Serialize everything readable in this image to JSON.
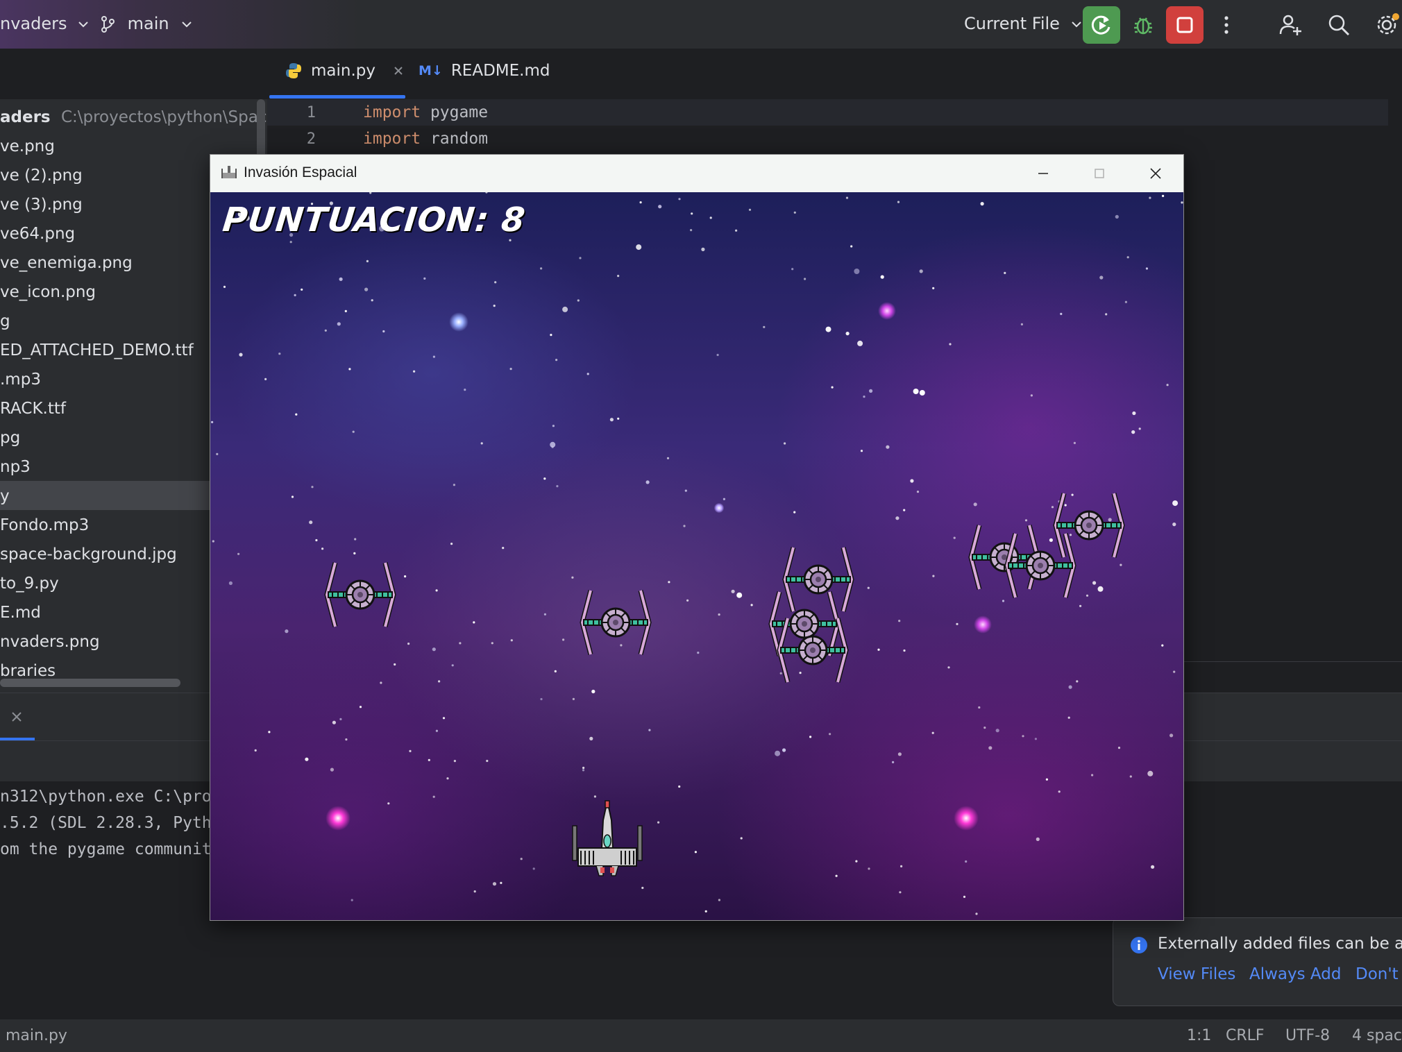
{
  "toolbar": {
    "project_name": "nvaders",
    "branch": "main",
    "run_config": "Current File",
    "colors": {
      "run_green": "#4e9a51",
      "stop_red": "#d1403d",
      "bug_green": "#5fb865"
    }
  },
  "tabs": [
    {
      "label": "main.py",
      "icon": "python-icon"
    },
    {
      "label": "README.md",
      "icon": "markdown-icon"
    }
  ],
  "project_tree": {
    "root_name": "aders",
    "root_path": "C:\\proyectos\\python\\SpaceIn",
    "items": [
      "ve.png",
      "ve (2).png",
      "ve (3).png",
      "ve64.png",
      "ve_enemiga.png",
      "ve_icon.png",
      "g",
      "ED_ATTACHED_DEMO.ttf",
      ".mp3",
      "RACK.ttf",
      "pg",
      "np3",
      "y",
      "Fondo.mp3",
      "space-background.jpg",
      "to_9.py",
      "E.md",
      "nvaders.png",
      "braries"
    ]
  },
  "editor": {
    "lines": [
      {
        "number": "1",
        "keyword": "import",
        "name": "pygame"
      },
      {
        "number": "2",
        "keyword": "import",
        "name": "random"
      }
    ]
  },
  "console": {
    "lines": [
      "n312\\python.exe C:\\pro",
      ".5.2 (SDL 2.28.3, Pyth",
      "om the pygame communit"
    ]
  },
  "game_window": {
    "title": "Invasión Espacial",
    "score_text": "PUNTUACION: 8"
  },
  "notification": {
    "message": "Externally added files can be add",
    "links": [
      "View Files",
      "Always Add",
      "Don't A"
    ]
  },
  "statusbar": {
    "file": "main.py",
    "position": "1:1",
    "line_sep": "CRLF",
    "encoding": "UTF-8",
    "indent": "4 spac"
  }
}
